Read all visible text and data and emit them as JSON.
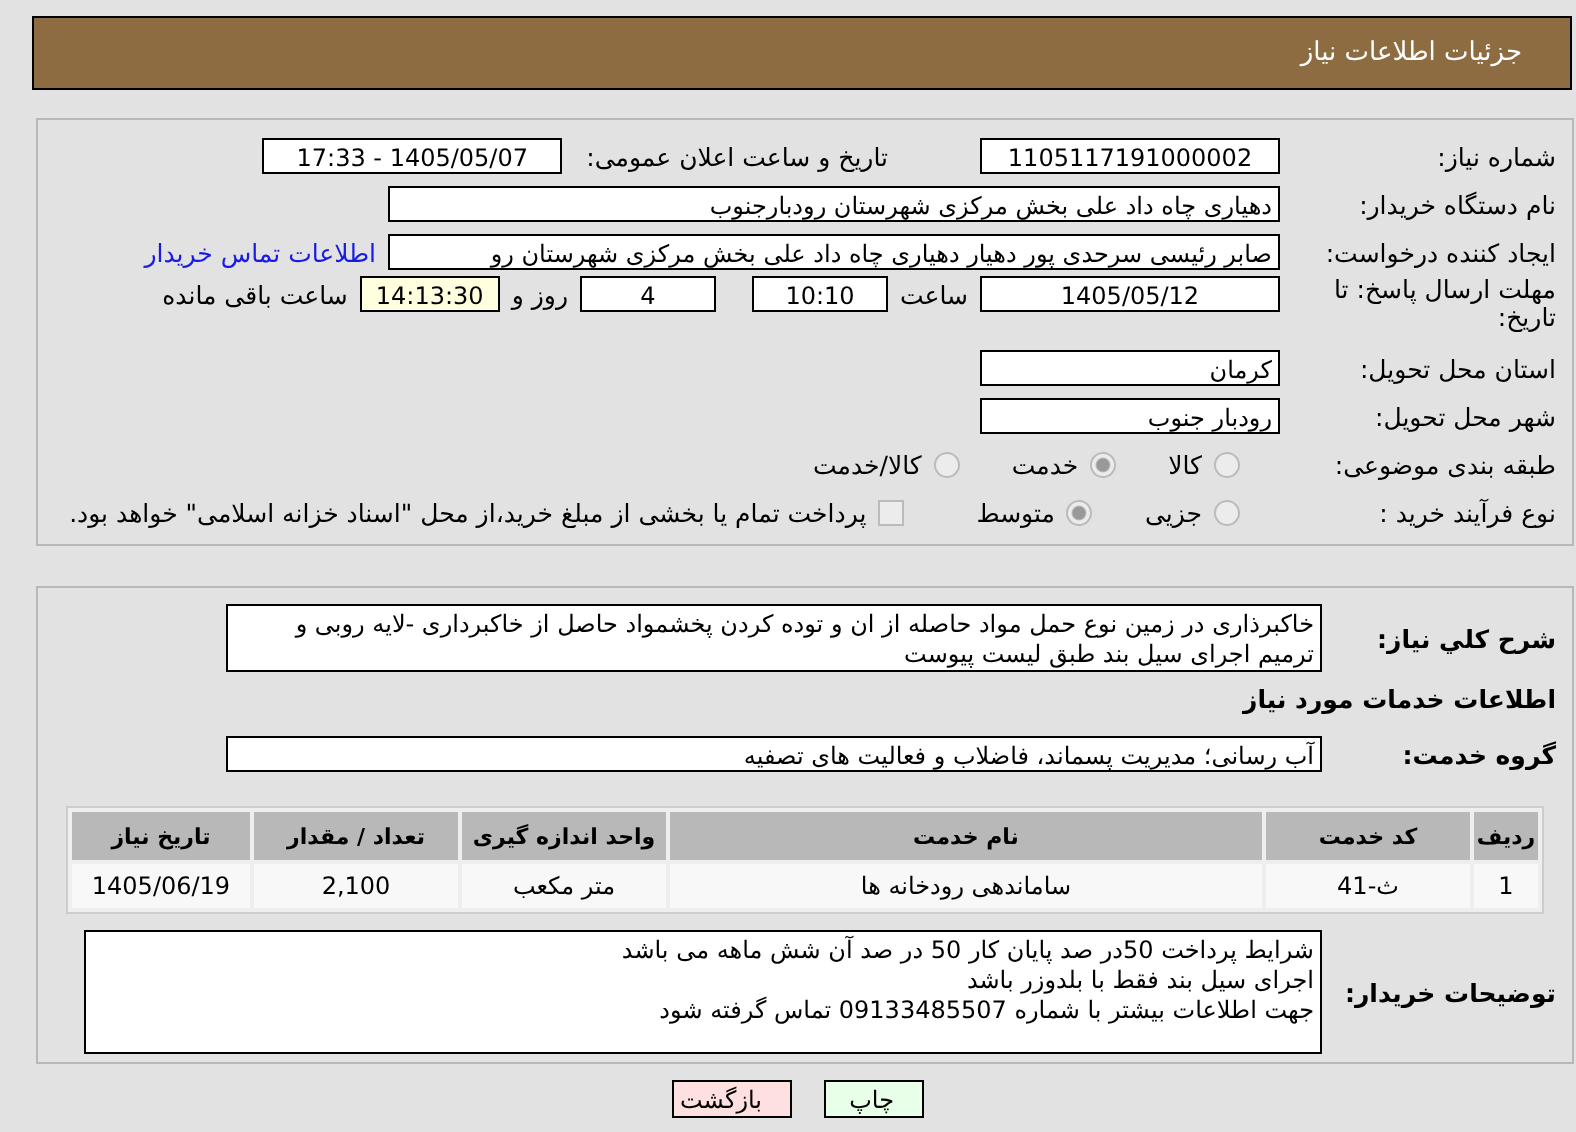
{
  "header": {
    "title": "جزئیات اطلاعات نیاز"
  },
  "fields": {
    "need_number": {
      "label": "شماره نیاز:",
      "value": "1105117191000002"
    },
    "announce": {
      "label": "تاریخ و ساعت اعلان عمومی:",
      "value": "1405/05/07 - 17:33"
    },
    "buyer": {
      "label": "نام دستگاه خریدار:",
      "value": "دهیاری چاه داد علی بخش مرکزی شهرستان رودبارجنوب"
    },
    "creator": {
      "label": "ایجاد کننده درخواست:",
      "value": "صابر رئیسی سرحدی پور دهیار دهیاری چاه داد علی بخش مرکزی شهرستان رو",
      "link": "اطلاعات تماس خریدار"
    },
    "deadline": {
      "label": "مهلت ارسال پاسخ: تا تاریخ:",
      "date": "1405/05/12",
      "time_label": "ساعت",
      "time": "10:10",
      "days": "4",
      "days_label": "روز و",
      "remaining": "14:13:30",
      "remaining_label": "ساعت باقی مانده"
    },
    "province": {
      "label": "استان محل تحویل:",
      "value": "کرمان"
    },
    "city": {
      "label": "شهر محل تحویل:",
      "value": "رودبار جنوب"
    }
  },
  "category": {
    "label": "طبقه بندی موضوعی:",
    "options": [
      {
        "label": "کالا",
        "selected": false
      },
      {
        "label": "خدمت",
        "selected": true
      },
      {
        "label": "کالا/خدمت",
        "selected": false
      }
    ]
  },
  "process": {
    "label": "نوع فرآیند خرید :",
    "options": [
      {
        "label": "جزیی",
        "selected": false
      },
      {
        "label": "متوسط",
        "selected": true
      }
    ],
    "payment": {
      "label": "پرداخت تمام یا بخشی از مبلغ خرید،از محل \"اسناد خزانه اسلامی\" خواهد بود.",
      "checked": false
    }
  },
  "description": {
    "label": "شرح کلي نیاز:",
    "value": "خاکبرذاری در زمین نوع حمل مواد حاصله از ان و توده کردن پخشمواد حاصل از خاکبرداری -لایه روبی و ترمیم اجرای سیل بند طبق لیست پیوست"
  },
  "services_title": "اطلاعات خدمات مورد نیاز",
  "service_group": {
    "label": "گروه خدمت:",
    "value": "آب رسانی؛ مدیریت پسماند، فاضلاب و فعالیت های تصفیه"
  },
  "table": {
    "columns": [
      "ردیف",
      "کد خدمت",
      "نام خدمت",
      "واحد اندازه گیری",
      "تعداد / مقدار",
      "تاریخ نیاز"
    ],
    "rows": [
      [
        "1",
        "ث-41",
        "ساماندهی رودخانه ها",
        "متر مکعب",
        "2,100",
        "1405/06/19"
      ]
    ]
  },
  "buyer_notes": {
    "label": "توضیحات خریدار:",
    "lines": [
      "شرایط پرداخت 50در صد پایان کار 50 در صد آن شش ماهه می باشد",
      "اجرای سیل بند فقط با بلدوزر باشد",
      "جهت اطلاعات بیشتر با شماره 09133485507 تماس گرفته شود"
    ]
  },
  "buttons": [
    {
      "label": "چاپ",
      "kind": "print"
    },
    {
      "label": "بازگشت",
      "kind": "back"
    }
  ]
}
